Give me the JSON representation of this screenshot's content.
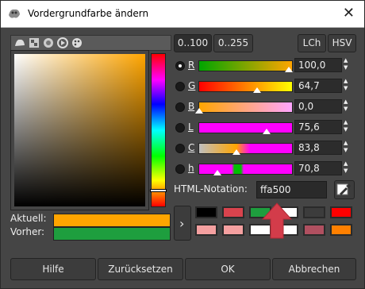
{
  "window": {
    "title": "Vordergrundfarbe ändern",
    "close_glyph": "✕"
  },
  "range_buttons": [
    "0..100",
    "0..255"
  ],
  "mode_buttons": [
    "LCh",
    "HSV"
  ],
  "channels": [
    {
      "label": "R",
      "value": "100,0",
      "selected": true,
      "level": 1.0,
      "gradient": "linear-gradient(to right, #00a500, #ffa500)"
    },
    {
      "label": "G",
      "value": "64,7",
      "selected": false,
      "level": 0.647,
      "gradient": "linear-gradient(to right, #ff0000, #ffff00)"
    },
    {
      "label": "B",
      "value": "0,0",
      "selected": false,
      "level": 0.0,
      "gradient": "linear-gradient(to right, #ffa500, #ffa5ff)"
    },
    {
      "label": "L",
      "value": "75,6",
      "selected": false,
      "level": 0.756,
      "gradient": "linear-gradient(to right, #ff00ff, #ff00ff)"
    },
    {
      "label": "C",
      "value": "83,8",
      "selected": false,
      "level": 0.42,
      "gradient": "linear-gradient(to right, #bfbfbf, #ffa500 40%, #ff00ff 55%, #ff00ff)"
    },
    {
      "label": "h",
      "value": "70,8",
      "selected": false,
      "level": 0.2,
      "gradient": "linear-gradient(to right, #ff00ff 35%, #00c000 38%, #00c000 45%, #ff00ff 48%)"
    }
  ],
  "html_notation": {
    "label": "HTML-Notation:",
    "value": "ffa500"
  },
  "swatches": {
    "current_label": "Aktuell:",
    "previous_label": "Vorher:",
    "current_color": "#ffa500",
    "previous_color": "#1e9e3e"
  },
  "history_colors": [
    "#000000",
    "#d9434d",
    "#1e9e3e",
    "#ffffff",
    "#3c3c3c",
    "#ff0000",
    "#f4a0a0",
    "#f4a0a0",
    "#ffffff",
    "#ffffff",
    "#b05060",
    "#ff8000"
  ],
  "buttons": {
    "help": "Hilfe",
    "reset": "Zurücksetzen",
    "ok": "OK",
    "cancel": "Abbrechen"
  },
  "hue_marker_level": 0.89
}
